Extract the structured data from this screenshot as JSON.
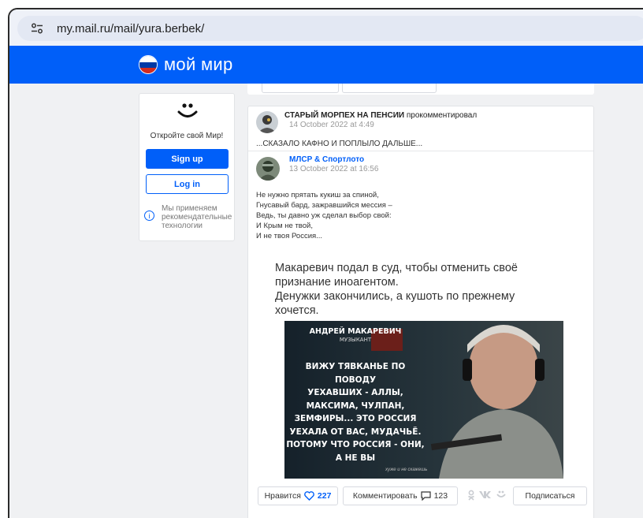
{
  "browser": {
    "url": "my.mail.ru/mail/yura.berbek/"
  },
  "brand": {
    "name": "мой мир"
  },
  "sidebar": {
    "title": "Откройте свой Мир!",
    "signup_label": "Sign up",
    "login_label": "Log in",
    "recommend_text": "Мы применяем\nрекомендательные\nтехнологии"
  },
  "comment": {
    "author": "СТАРЫЙ МОРПЕХ НА ПЕНСИИ",
    "action": "прокомментировал",
    "date": "14 October 2022 at 4:49",
    "text": "...СКАЗАЛО КАФНО И ПОПЛЫЛО ДАЛЬШЕ..."
  },
  "post": {
    "author": "МЛСР & Спортлото",
    "date": "13 October 2022 at 16:56",
    "poem": [
      "Не нужно прятать кукиш за спиной,",
      "Гнусавый бард, зажравшийся мессия –",
      "Ведь, ты давно уж сделал выбор свой:",
      "И Крым не твой,",
      "И не твоя Россия..."
    ],
    "body": [
      "Макаревич подал в суд, чтобы отменить своё",
      "признание иноагентом.",
      "Денужки закончились, а кушоть по прежнему",
      "хочется."
    ],
    "image": {
      "name": "АНДРЕЙ МАКАРЕВИЧ",
      "role": "МУЗЫКАНТ",
      "quote": [
        "ВИЖУ ТЯВКАНЬЕ ПО ПОВОДУ",
        "УЕХАВШИХ - АЛЛЫ,",
        "МАКСИМА, ЧУЛПАН,",
        "ЗЕМФИРЫ... ЭТО РОССИЯ",
        "УЕХАЛА ОТ ВАС, МУДАЧЬЁ.",
        "ПОТОМУ ЧТО РОССИЯ - ОНИ,",
        "А НЕ ВЫ"
      ],
      "signature": "хуже и не скажешь"
    },
    "actions": {
      "like_label": "Нравится",
      "like_count": "227",
      "comment_label": "Комментировать",
      "comment_count": "123",
      "subscribe_label": "Подписаться"
    }
  },
  "colors": {
    "brand_blue": "#005ff9",
    "page_bg": "#f0f1f3"
  }
}
